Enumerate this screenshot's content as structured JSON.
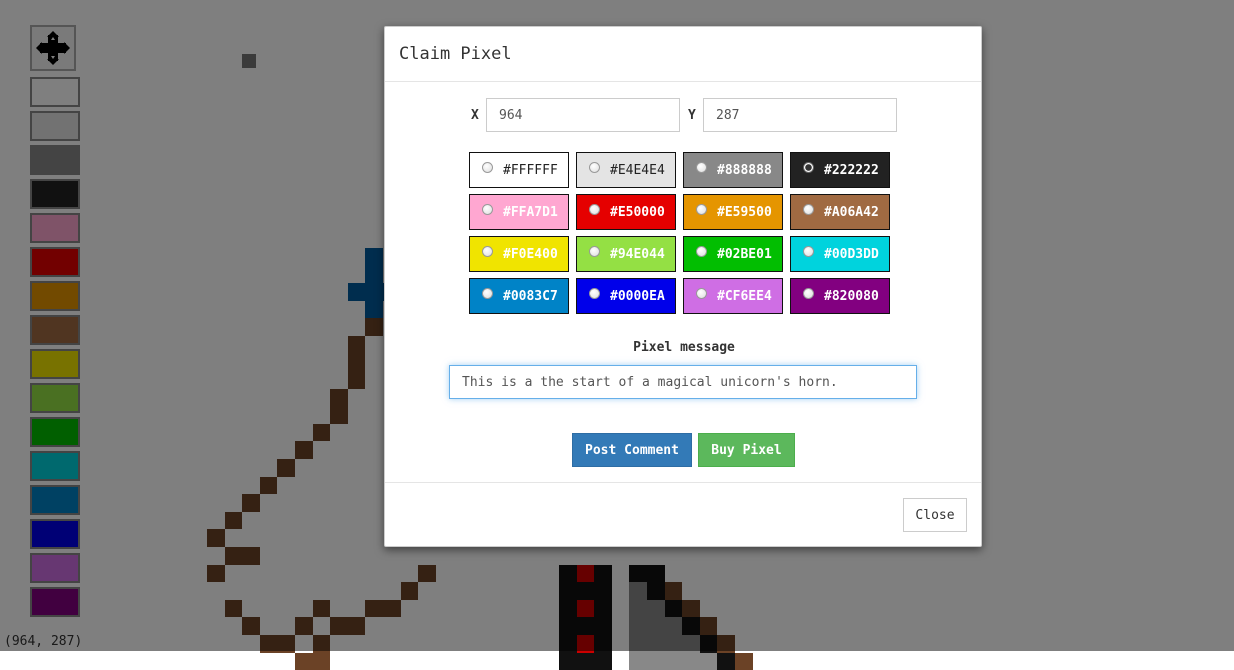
{
  "canvas": {
    "pixels": [
      {
        "col": 12,
        "row": 2,
        "c": "#777777"
      },
      {
        "col": 19,
        "row": 13,
        "c": "#005a9c"
      },
      {
        "col": 19,
        "row": 14,
        "c": "#005a9c"
      },
      {
        "col": 18,
        "row": 15,
        "c": "#005a9c"
      },
      {
        "col": 19,
        "row": 15,
        "c": "#005a9c"
      },
      {
        "col": 20,
        "row": 15,
        "c": "#005a9c"
      },
      {
        "col": 19,
        "row": 16,
        "c": "#005a9c"
      },
      {
        "col": 19,
        "row": 17,
        "c": "#6b4226"
      },
      {
        "col": 18,
        "row": 18,
        "c": "#6b4226"
      },
      {
        "col": 18,
        "row": 19,
        "c": "#6b4226"
      },
      {
        "col": 18,
        "row": 20,
        "c": "#6b4226"
      },
      {
        "col": 17,
        "row": 21,
        "c": "#6b4226"
      },
      {
        "col": 17,
        "row": 22,
        "c": "#6b4226"
      },
      {
        "col": 16,
        "row": 23,
        "c": "#6b4226"
      },
      {
        "col": 15,
        "row": 24,
        "c": "#6b4226"
      },
      {
        "col": 14,
        "row": 25,
        "c": "#6b4226"
      },
      {
        "col": 13,
        "row": 26,
        "c": "#6b4226"
      },
      {
        "col": 12,
        "row": 27,
        "c": "#6b4226"
      },
      {
        "col": 11,
        "row": 28,
        "c": "#6b4226"
      },
      {
        "col": 10,
        "row": 29,
        "c": "#6b4226"
      },
      {
        "col": 11,
        "row": 30,
        "c": "#6b4226"
      },
      {
        "col": 12,
        "row": 30,
        "c": "#6b4226"
      },
      {
        "col": 10,
        "row": 31,
        "c": "#6b4226"
      },
      {
        "col": 22,
        "row": 31,
        "c": "#6b4226"
      },
      {
        "col": 21,
        "row": 32,
        "c": "#6b4226"
      },
      {
        "col": 20,
        "row": 33,
        "c": "#6b4226"
      },
      {
        "col": 19,
        "row": 33,
        "c": "#6b4226"
      },
      {
        "col": 11,
        "row": 33,
        "c": "#6b4226"
      },
      {
        "col": 12,
        "row": 34,
        "c": "#6b4226"
      },
      {
        "col": 13,
        "row": 35,
        "c": "#6b4226"
      },
      {
        "col": 14,
        "row": 35,
        "c": "#6b4226"
      },
      {
        "col": 15,
        "row": 34,
        "c": "#6b4226"
      },
      {
        "col": 16,
        "row": 33,
        "c": "#6b4226"
      },
      {
        "col": 17,
        "row": 34,
        "c": "#6b4226"
      },
      {
        "col": 18,
        "row": 34,
        "c": "#6b4226"
      },
      {
        "col": 16,
        "row": 35,
        "c": "#6b4226"
      },
      {
        "col": 15,
        "row": 36,
        "c": "#6b4226"
      },
      {
        "col": 16,
        "row": 36,
        "c": "#6b4226"
      },
      {
        "col": 30,
        "row": 31,
        "c": "#111111"
      },
      {
        "col": 31,
        "row": 31,
        "c": "#cc0000"
      },
      {
        "col": 32,
        "row": 31,
        "c": "#111111"
      },
      {
        "col": 30,
        "row": 32,
        "c": "#111111"
      },
      {
        "col": 31,
        "row": 32,
        "c": "#111111"
      },
      {
        "col": 32,
        "row": 32,
        "c": "#111111"
      },
      {
        "col": 30,
        "row": 33,
        "c": "#111111"
      },
      {
        "col": 31,
        "row": 33,
        "c": "#cc0000"
      },
      {
        "col": 32,
        "row": 33,
        "c": "#111111"
      },
      {
        "col": 30,
        "row": 34,
        "c": "#111111"
      },
      {
        "col": 31,
        "row": 34,
        "c": "#111111"
      },
      {
        "col": 32,
        "row": 34,
        "c": "#111111"
      },
      {
        "col": 30,
        "row": 35,
        "c": "#111111"
      },
      {
        "col": 31,
        "row": 35,
        "c": "#cc0000"
      },
      {
        "col": 32,
        "row": 35,
        "c": "#111111"
      },
      {
        "col": 30,
        "row": 36,
        "c": "#111111"
      },
      {
        "col": 31,
        "row": 36,
        "c": "#111111"
      },
      {
        "col": 32,
        "row": 36,
        "c": "#111111"
      },
      {
        "col": 34,
        "row": 31,
        "c": "#111111"
      },
      {
        "col": 35,
        "row": 31,
        "c": "#111111"
      },
      {
        "col": 34,
        "row": 32,
        "c": "#888888"
      },
      {
        "col": 35,
        "row": 32,
        "c": "#111111"
      },
      {
        "col": 36,
        "row": 32,
        "c": "#6b4226"
      },
      {
        "col": 34,
        "row": 33,
        "c": "#888888"
      },
      {
        "col": 35,
        "row": 33,
        "c": "#888888"
      },
      {
        "col": 36,
        "row": 33,
        "c": "#111111"
      },
      {
        "col": 37,
        "row": 33,
        "c": "#6b4226"
      },
      {
        "col": 34,
        "row": 34,
        "c": "#888888"
      },
      {
        "col": 35,
        "row": 34,
        "c": "#888888"
      },
      {
        "col": 36,
        "row": 34,
        "c": "#888888"
      },
      {
        "col": 37,
        "row": 34,
        "c": "#111111"
      },
      {
        "col": 38,
        "row": 34,
        "c": "#6b4226"
      },
      {
        "col": 34,
        "row": 35,
        "c": "#888888"
      },
      {
        "col": 35,
        "row": 35,
        "c": "#888888"
      },
      {
        "col": 36,
        "row": 35,
        "c": "#888888"
      },
      {
        "col": 37,
        "row": 35,
        "c": "#888888"
      },
      {
        "col": 38,
        "row": 35,
        "c": "#111111"
      },
      {
        "col": 39,
        "row": 35,
        "c": "#6b4226"
      },
      {
        "col": 34,
        "row": 36,
        "c": "#888888"
      },
      {
        "col": 35,
        "row": 36,
        "c": "#888888"
      },
      {
        "col": 36,
        "row": 36,
        "c": "#888888"
      },
      {
        "col": 37,
        "row": 36,
        "c": "#888888"
      },
      {
        "col": 38,
        "row": 36,
        "c": "#888888"
      },
      {
        "col": 39,
        "row": 36,
        "c": "#111111"
      },
      {
        "col": 40,
        "row": 36,
        "c": "#6b4226"
      }
    ]
  },
  "palette": {
    "move_tool_icon": "move-arrows-icon",
    "swatches": [
      "#FFFFFF",
      "#E4E4E4",
      "#888888",
      "#222222",
      "#FFA7D1",
      "#E50000",
      "#E59500",
      "#A06A42",
      "#F0E400",
      "#94E044",
      "#02BE01",
      "#00D3DD",
      "#0083C7",
      "#0000EA",
      "#CF6EE4",
      "#820080"
    ]
  },
  "coord_readout": "(964, 287)",
  "modal": {
    "title": "Claim Pixel",
    "x_label": "X",
    "x_value": "964",
    "y_label": "Y",
    "y_value": "287",
    "selected_color": "#222222",
    "colors": [
      {
        "label": "#FFFFFF",
        "bg": "#FFFFFF",
        "fg": "#222222"
      },
      {
        "label": "#E4E4E4",
        "bg": "#E4E4E4",
        "fg": "#222222"
      },
      {
        "label": "#888888",
        "bg": "#888888",
        "fg": "#FFFFFF"
      },
      {
        "label": "#222222",
        "bg": "#222222",
        "fg": "#FFFFFF"
      },
      {
        "label": "#FFA7D1",
        "bg": "#FFA7D1",
        "fg": "#FFFFFF"
      },
      {
        "label": "#E50000",
        "bg": "#E50000",
        "fg": "#FFFFFF"
      },
      {
        "label": "#E59500",
        "bg": "#E59500",
        "fg": "#FFFFFF"
      },
      {
        "label": "#A06A42",
        "bg": "#A06A42",
        "fg": "#FFFFFF"
      },
      {
        "label": "#F0E400",
        "bg": "#F0E400",
        "fg": "#FFFFFF"
      },
      {
        "label": "#94E044",
        "bg": "#94E044",
        "fg": "#FFFFFF"
      },
      {
        "label": "#02BE01",
        "bg": "#02BE01",
        "fg": "#FFFFFF"
      },
      {
        "label": "#00D3DD",
        "bg": "#00D3DD",
        "fg": "#FFFFFF"
      },
      {
        "label": "#0083C7",
        "bg": "#0083C7",
        "fg": "#FFFFFF"
      },
      {
        "label": "#0000EA",
        "bg": "#0000EA",
        "fg": "#FFFFFF"
      },
      {
        "label": "#CF6EE4",
        "bg": "#CF6EE4",
        "fg": "#FFFFFF"
      },
      {
        "label": "#820080",
        "bg": "#820080",
        "fg": "#FFFFFF"
      }
    ],
    "message_label": "Pixel message",
    "message_value": "This is a the start of a magical unicorn's horn.",
    "post_label": "Post Comment",
    "buy_label": "Buy Pixel",
    "close_label": "Close"
  }
}
